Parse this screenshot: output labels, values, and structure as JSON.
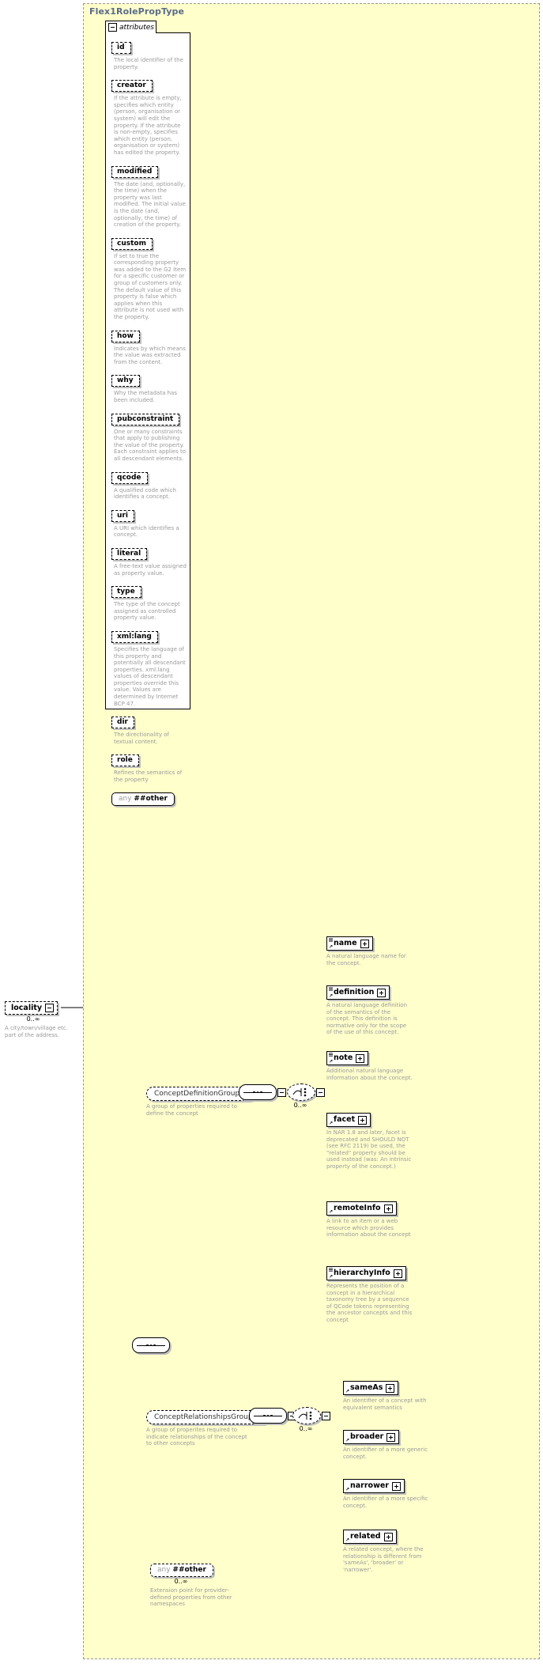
{
  "diagram": {
    "type_name": "Flex1RolePropType",
    "attributes_label": "attributes",
    "occurs_unbounded": "0..∞"
  },
  "attributes": [
    {
      "name": "id",
      "desc": "The local identifier of the property."
    },
    {
      "name": "creator",
      "desc": "If the attribute is empty, specifies which entity (person, organisation or system) will edit the property. If the attribute is non-empty, specifies which entity (person, organisation or system) has edited the property."
    },
    {
      "name": "modified",
      "desc": "The date (and, optionally, the time) when the property was last modified. The initial value is the date (and, optionally, the time) of creation of the property."
    },
    {
      "name": "custom",
      "desc": "If set to true the corresponding property was added to the G2 Item for a specific customer or group of customers only. The default value of this property is false which applies when this attribute is not used with the property."
    },
    {
      "name": "how",
      "desc": "Indicates by which means the value was extracted from the content."
    },
    {
      "name": "why",
      "desc": "Why the metadata has been included."
    },
    {
      "name": "pubconstraint",
      "desc": "One or many constraints that apply to publishing the value of the property. Each constraint applies to all descendant elements."
    },
    {
      "name": "qcode",
      "desc": "A qualified code which identifies a concept."
    },
    {
      "name": "uri",
      "desc": "A URI which identifies a concept."
    },
    {
      "name": "literal",
      "desc": "A free-text value assigned as property value."
    },
    {
      "name": "type",
      "desc": "The type of the concept assigned as controlled property value."
    },
    {
      "name": "xml:lang",
      "desc": "Specifies the language of this property and potentially all descendant properties. xml:lang values of descendant properties override this value. Values are determined by Internet BCP 47."
    },
    {
      "name": "dir",
      "desc": "The directionality of textual content."
    },
    {
      "name": "role",
      "desc": "Refines the semantics of the property"
    }
  ],
  "attributes_any": {
    "any_label": "any",
    "namespace_label": "##other"
  },
  "locality": {
    "name": "locality",
    "occurs": "0..∞",
    "desc": "A city/town/village etc. part of the address."
  },
  "groups": [
    {
      "name": "ConceptDefinitionGroup",
      "desc": "A group of properties required to define the concept",
      "occurs": "0..∞",
      "children": [
        {
          "name": "name",
          "desc": "A natural language name for the concept."
        },
        {
          "name": "definition",
          "desc": "A natural language definition of the semantics of the concept. This definition is normative only for the scope of the use of this concept."
        },
        {
          "name": "note",
          "desc": "Additional natural language information about the concept."
        },
        {
          "name": "facet",
          "desc": "In NAR 1.8 and later, facet is deprecated and SHOULD NOT (see RFC 2119) be used, the \"related\" property should be used instead (was: An intrinsic property of the concept.)"
        },
        {
          "name": "remoteInfo",
          "desc": "A link to an item or a web resource which provides information about the concept"
        },
        {
          "name": "hierarchyInfo",
          "desc": "Represents the position of a concept in a hierarchical taxonomy tree by a sequence of QCode tokens representing the ancestor concepts and this concept"
        }
      ]
    },
    {
      "name": "ConceptRelationshipsGroup",
      "desc": "A group of properites required to indicate relationships of the concept to other concepts",
      "occurs": "0..∞",
      "children": [
        {
          "name": "sameAs",
          "desc": "An identifier of a concept with equivalent semantics"
        },
        {
          "name": "broader",
          "desc": "An identifier of a more generic concept."
        },
        {
          "name": "narrower",
          "desc": "An identifier of a more specific concept."
        },
        {
          "name": "related",
          "desc": "A related concept, where the relationship is different from 'sameAs', 'broader' or 'narrower'."
        }
      ]
    }
  ],
  "content_any": {
    "any_label": "any",
    "namespace_label": "##other",
    "occurs": "0..∞",
    "desc": "Extension point for provider-defined properties from other namespaces"
  },
  "colors": {
    "type_background": "#ffffcc",
    "panel_background": "#ffffff",
    "title_text": "#5a6a8a",
    "description_text": "#9a9a9a",
    "line": "#000000",
    "shadow": "#c0c0c0"
  }
}
